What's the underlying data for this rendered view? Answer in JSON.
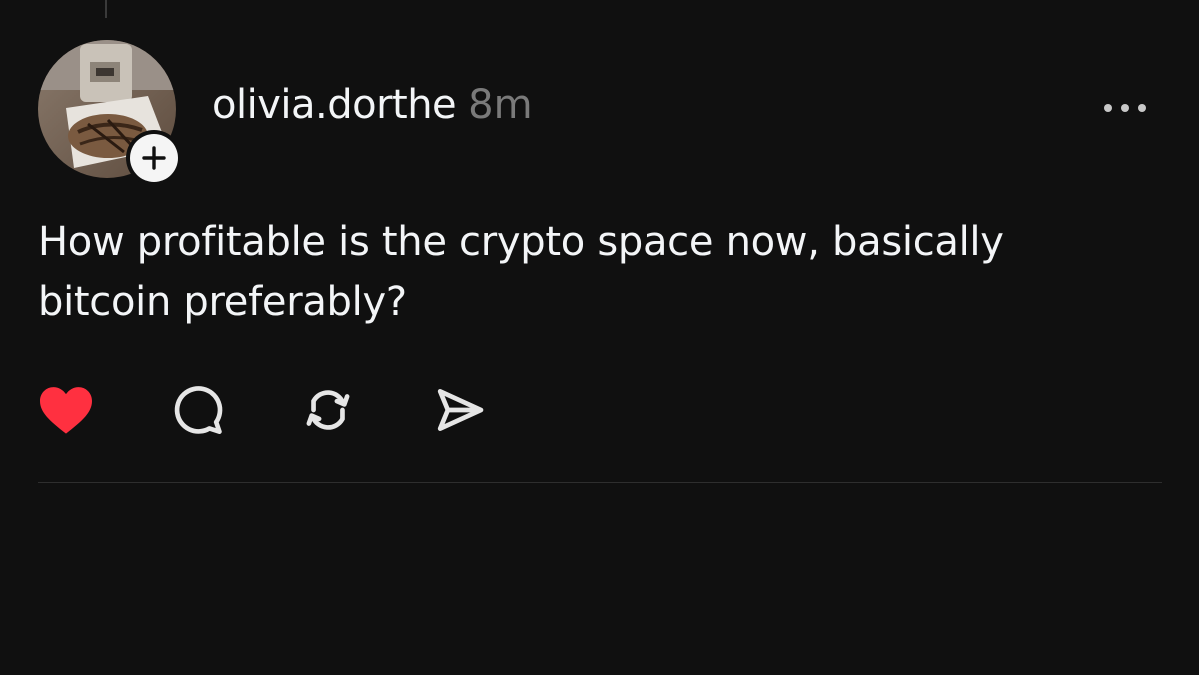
{
  "post": {
    "username": "olivia.dorthe",
    "time": "8m",
    "text_lines": [
      "How profitable is the crypto space now, basically",
      "bitcoin preferably?"
    ]
  },
  "icons": {
    "follow": "plus-icon",
    "more": "more-horizontal-icon",
    "like": "heart-icon",
    "comment": "comment-icon",
    "repost": "repost-icon",
    "share": "send-icon"
  },
  "state": {
    "liked": true
  },
  "colors": {
    "background": "#101010",
    "text": "#f3f5f7",
    "muted": "#7a7a7a",
    "like": "#ff3040",
    "divider": "#2e2e2e"
  }
}
